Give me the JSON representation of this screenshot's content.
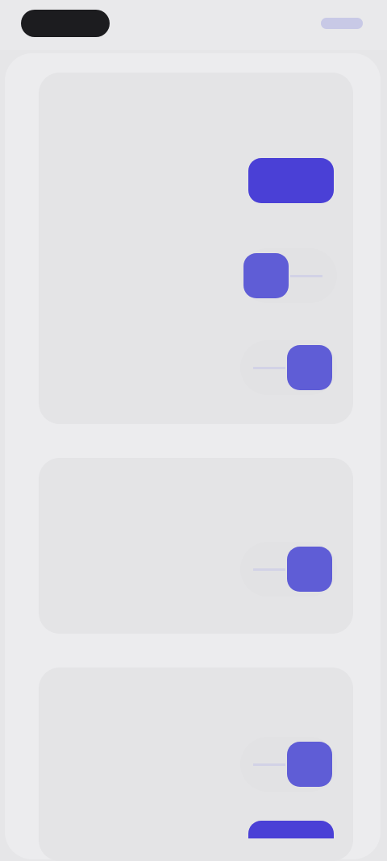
{
  "colors": {
    "accent": "#5f5dd6",
    "button": "#4a40d6",
    "text": "#6465c7",
    "card": "#e4e4e6",
    "background": "#e6e6e8"
  },
  "sections": [
    {
      "title": "",
      "rows": [
        {
          "label": "",
          "control": "button",
          "button_label": ""
        },
        {
          "label": "",
          "control": "toggle",
          "state": "off"
        },
        {
          "label": "",
          "control": "toggle",
          "state": "on"
        }
      ]
    },
    {
      "title": "",
      "rows": [
        {
          "label": "",
          "control": "toggle",
          "state": "on"
        }
      ]
    },
    {
      "title": "",
      "rows": [
        {
          "label": "",
          "control": "toggle",
          "state": "on"
        },
        {
          "label": "",
          "control": "button",
          "button_label": ""
        }
      ]
    }
  ]
}
